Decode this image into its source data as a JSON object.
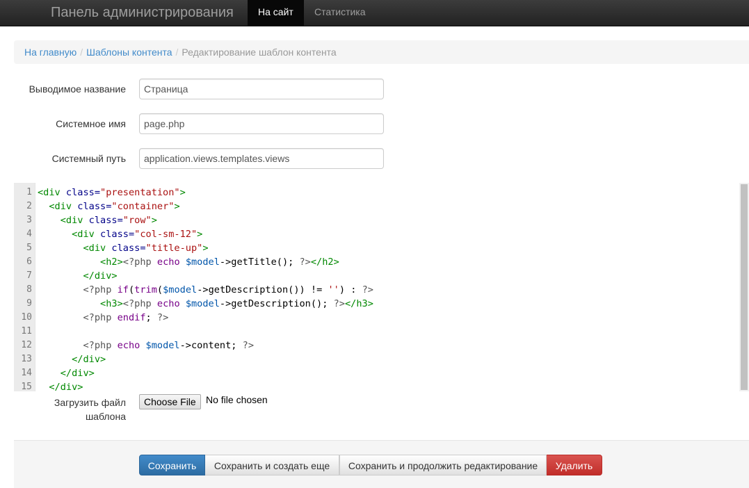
{
  "navbar": {
    "brand": "Панель администрирования",
    "items": [
      {
        "label": "На сайт",
        "active": true
      },
      {
        "label": "Статистика",
        "active": false
      }
    ]
  },
  "breadcrumb": {
    "items": [
      "На главную",
      "Шаблоны контента"
    ],
    "separator": "/",
    "current": "Редактирование шаблон контента"
  },
  "form": {
    "display_name": {
      "label": "Выводимое название",
      "value": "Страница"
    },
    "system_name": {
      "label": "Системное имя",
      "value": "page.php"
    },
    "system_path": {
      "label": "Системный путь",
      "value": "application.views.templates.views"
    }
  },
  "editor": {
    "lines": [
      {
        "num": "1",
        "tokens": [
          [
            "tag",
            "<div "
          ],
          [
            "attr",
            "class="
          ],
          [
            "str",
            "\"presentation\""
          ],
          [
            "tag",
            ">"
          ]
        ]
      },
      {
        "num": "2",
        "tokens": [
          [
            "plain",
            "  "
          ],
          [
            "tag",
            "<div "
          ],
          [
            "attr",
            "class="
          ],
          [
            "str",
            "\"container\""
          ],
          [
            "tag",
            ">"
          ]
        ]
      },
      {
        "num": "3",
        "tokens": [
          [
            "plain",
            "    "
          ],
          [
            "tag",
            "<div "
          ],
          [
            "attr",
            "class="
          ],
          [
            "str",
            "\"row\""
          ],
          [
            "tag",
            ">"
          ]
        ]
      },
      {
        "num": "4",
        "tokens": [
          [
            "plain",
            "      "
          ],
          [
            "tag",
            "<div "
          ],
          [
            "attr",
            "class="
          ],
          [
            "str",
            "\"col-sm-12\""
          ],
          [
            "tag",
            ">"
          ]
        ]
      },
      {
        "num": "5",
        "tokens": [
          [
            "plain",
            "        "
          ],
          [
            "tag",
            "<div "
          ],
          [
            "attr",
            "class="
          ],
          [
            "str",
            "\"title-up\""
          ],
          [
            "tag",
            ">"
          ]
        ]
      },
      {
        "num": "6",
        "tokens": [
          [
            "plain",
            "           "
          ],
          [
            "tag",
            "<h2>"
          ],
          [
            "php",
            "<?php "
          ],
          [
            "kw",
            "echo "
          ],
          [
            "var",
            "$model"
          ],
          [
            "plain",
            "->getTitle(); "
          ],
          [
            "php",
            "?>"
          ],
          [
            "tag",
            "</h2>"
          ]
        ]
      },
      {
        "num": "7",
        "tokens": [
          [
            "plain",
            "        "
          ],
          [
            "tag",
            "</div>"
          ]
        ]
      },
      {
        "num": "8",
        "tokens": [
          [
            "plain",
            "        "
          ],
          [
            "php",
            "<?php "
          ],
          [
            "kw",
            "if"
          ],
          [
            "plain",
            "("
          ],
          [
            "kw",
            "trim"
          ],
          [
            "plain",
            "("
          ],
          [
            "var",
            "$model"
          ],
          [
            "plain",
            "->getDescription()) != "
          ],
          [
            "str",
            "''"
          ],
          [
            "plain",
            ") : "
          ],
          [
            "php",
            "?>"
          ]
        ]
      },
      {
        "num": "9",
        "tokens": [
          [
            "plain",
            "           "
          ],
          [
            "tag",
            "<h3>"
          ],
          [
            "php",
            "<?php "
          ],
          [
            "kw",
            "echo "
          ],
          [
            "var",
            "$model"
          ],
          [
            "plain",
            "->getDescription(); "
          ],
          [
            "php",
            "?>"
          ],
          [
            "tag",
            "</h3>"
          ]
        ]
      },
      {
        "num": "10",
        "tokens": [
          [
            "plain",
            "        "
          ],
          [
            "php",
            "<?php "
          ],
          [
            "kw",
            "endif"
          ],
          [
            "plain",
            "; "
          ],
          [
            "php",
            "?>"
          ]
        ]
      },
      {
        "num": "11",
        "tokens": []
      },
      {
        "num": "12",
        "tokens": [
          [
            "plain",
            "        "
          ],
          [
            "php",
            "<?php "
          ],
          [
            "kw",
            "echo "
          ],
          [
            "var",
            "$model"
          ],
          [
            "plain",
            "->content; "
          ],
          [
            "php",
            "?>"
          ]
        ]
      },
      {
        "num": "13",
        "tokens": [
          [
            "plain",
            "      "
          ],
          [
            "tag",
            "</div>"
          ]
        ]
      },
      {
        "num": "14",
        "tokens": [
          [
            "plain",
            "    "
          ],
          [
            "tag",
            "</div>"
          ]
        ]
      },
      {
        "num": "15",
        "tokens": [
          [
            "plain",
            "  "
          ],
          [
            "tag",
            "</div>"
          ]
        ]
      }
    ]
  },
  "upload": {
    "label": "Загрузить файл шаблона",
    "button": "Choose File",
    "status": "No file chosen"
  },
  "actions": {
    "save": "Сохранить",
    "save_and_create": "Сохранить и создать еще",
    "save_and_continue": "Сохранить и продолжить редактирование",
    "delete": "Удалить"
  },
  "colors": {
    "primary": "#428bca",
    "danger": "#d9534f",
    "navbar": "#222222",
    "link": "#428bca"
  }
}
